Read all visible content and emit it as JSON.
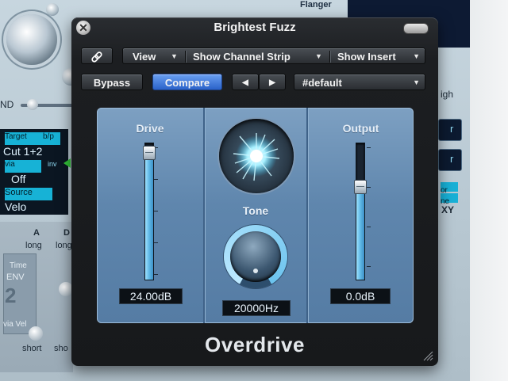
{
  "background": {
    "flanger_label": "Flanger",
    "nd_label": "ND",
    "mod_matrix": {
      "target_label": "Target",
      "bp_label": "b/p",
      "target_value": "Cut 1+2",
      "via_label": "via",
      "inv_label": "inv",
      "via_value": "Off",
      "source_label": "Source",
      "source_value": "Velo"
    },
    "env": {
      "a_label": "A",
      "d_label": "D",
      "long_a": "long",
      "long_d": "long",
      "time_label": "Time",
      "env_label": "ENV",
      "env_number": "2",
      "via_vel_label": "via Vel",
      "short_label": "short",
      "short_label2": "sho"
    },
    "right_fragments": {
      "igh": "igh",
      "r1": "r",
      "r2": "r",
      "or": "or",
      "ne": "ne",
      "xy": "XY"
    }
  },
  "plugin": {
    "title": "Brightest Fuzz",
    "close_glyph": "✕",
    "toolbar": {
      "link_glyph": "🔗",
      "view_label": "View",
      "channel_strip_label": "Show Channel Strip",
      "show_insert_label": "Show Insert",
      "arrow_glyph": "▼"
    },
    "presets": {
      "bypass_label": "Bypass",
      "compare_label": "Compare",
      "prev_glyph": "◀",
      "next_glyph": "▶",
      "preset_name": "#default",
      "preset_arrow": "▼"
    },
    "controls": {
      "drive": {
        "label": "Drive",
        "value": "24.00dB",
        "level": 0.97
      },
      "tone": {
        "label": "Tone",
        "value": "20000Hz",
        "level": 1.0
      },
      "output": {
        "label": "Output",
        "value": "0.0dB",
        "level": 0.72
      }
    },
    "name": "Overdrive"
  },
  "colors": {
    "accent_blue": "#2a62c9",
    "panel_blue": "#5f86ad",
    "slider_fill": "#5fb8e6"
  }
}
